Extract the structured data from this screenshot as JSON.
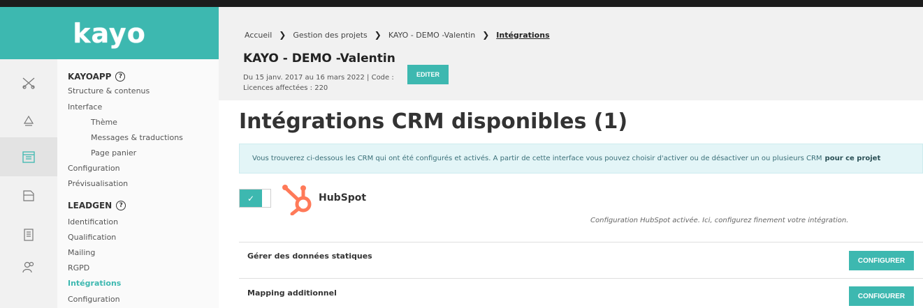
{
  "logo": {
    "text": "kayo"
  },
  "breadcrumb": {
    "items": [
      "Accueil",
      "Gestion des projets",
      "KAYO - DEMO -Valentin"
    ],
    "current": "Intégrations",
    "separator": "❯"
  },
  "project": {
    "title": "KAYO - DEMO -Valentin",
    "meta_line1": "Du 15 janv. 2017 au 16 mars 2022 | Code :",
    "meta_line2": "Licences affectées : 220",
    "edit_label": "EDITER"
  },
  "sidebar": {
    "icons": [
      "scissors-icon",
      "recycle-icon",
      "calendar-icon",
      "folder-icon",
      "building-icon",
      "users-icon"
    ],
    "active_icon_index": 2,
    "sections": [
      {
        "title": "KAYOAPP",
        "help": "?",
        "items": [
          "Structure & contenus",
          "Interface",
          "Thème",
          "Messages & traductions",
          "Page panier",
          "Configuration",
          "Prévisualisation"
        ]
      },
      {
        "title": "LEADGEN",
        "help": "?",
        "items": [
          "Identification",
          "Qualification",
          "Mailing",
          "RGPD",
          "Intégrations",
          "Configuration"
        ]
      }
    ]
  },
  "main": {
    "title": "Intégrations CRM disponibles (1)",
    "info_text": "Vous trouverez ci-dessous les CRM qui ont été configurés et activés. A partir de cette interface vous pouvez choisir d'activer ou de désactiver un ou plusieurs CRM",
    "info_bold": "pour ce projet",
    "integration": {
      "name": "HubSpot",
      "enabled": true,
      "toggle_glyph": "✓",
      "note": "Configuration HubSpot activée. Ici, configurez finement votre intégration.",
      "brand_color": "#ff7a59"
    },
    "rows": [
      {
        "label": "Gérer des données statiques",
        "button": "CONFIGURER"
      },
      {
        "label": "Mapping additionnel",
        "button": "CONFIGURER"
      }
    ]
  },
  "colors": {
    "accent": "#3db8b0",
    "dark": "#1c1c1c",
    "info_bg": "#e3f5f7"
  }
}
